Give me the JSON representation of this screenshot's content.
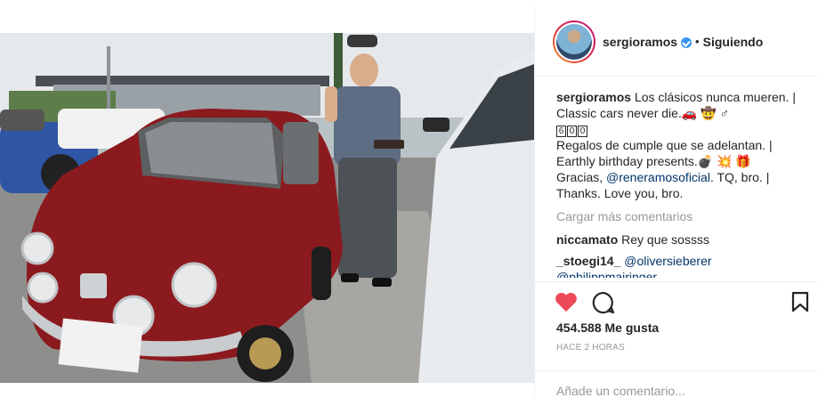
{
  "post": {
    "username": "sergioramos",
    "follow_separator": "•",
    "follow_label": "Siguiendo",
    "caption_lines": [
      "Los clásicos nunca mueren. |",
      "Classic cars never die.🚗 🤠 ♂",
      "Regalos de cumple que se adelantan. |",
      "Earthly birthday presents.💣 💥 🎁",
      "Thanks. Love you, bro."
    ],
    "caption_boxed_digits": [
      "6",
      "0",
      "0"
    ],
    "caption_gracias_prefix": "Gracias, ",
    "caption_mention": "@reneramosoficial",
    "caption_gracias_suffix": ". TQ, bro. |",
    "load_more": "Cargar más comentarios",
    "comments": [
      {
        "user": "niccamato",
        "text": "Rey que sossss",
        "mention": ""
      },
      {
        "user": "_stoegi14_",
        "text": "",
        "mention": "@oliversieberer"
      },
      {
        "user": "",
        "text": "",
        "mention": "@philippmairinger"
      }
    ],
    "likes": "454.588 Me gusta",
    "time": "HACE 2 HORAS",
    "add_comment_placeholder": "Añade un comentario..."
  },
  "carousel": {
    "count": 5,
    "active_index": 0
  },
  "colors": {
    "accent": "#3897f0",
    "heart": "#ed4956",
    "car": "#8b1a1f",
    "link": "#003569"
  },
  "icons": {
    "like": "heart-icon",
    "comment": "comment-bubble-icon",
    "save": "bookmark-icon",
    "verified": "verified-badge-icon"
  }
}
